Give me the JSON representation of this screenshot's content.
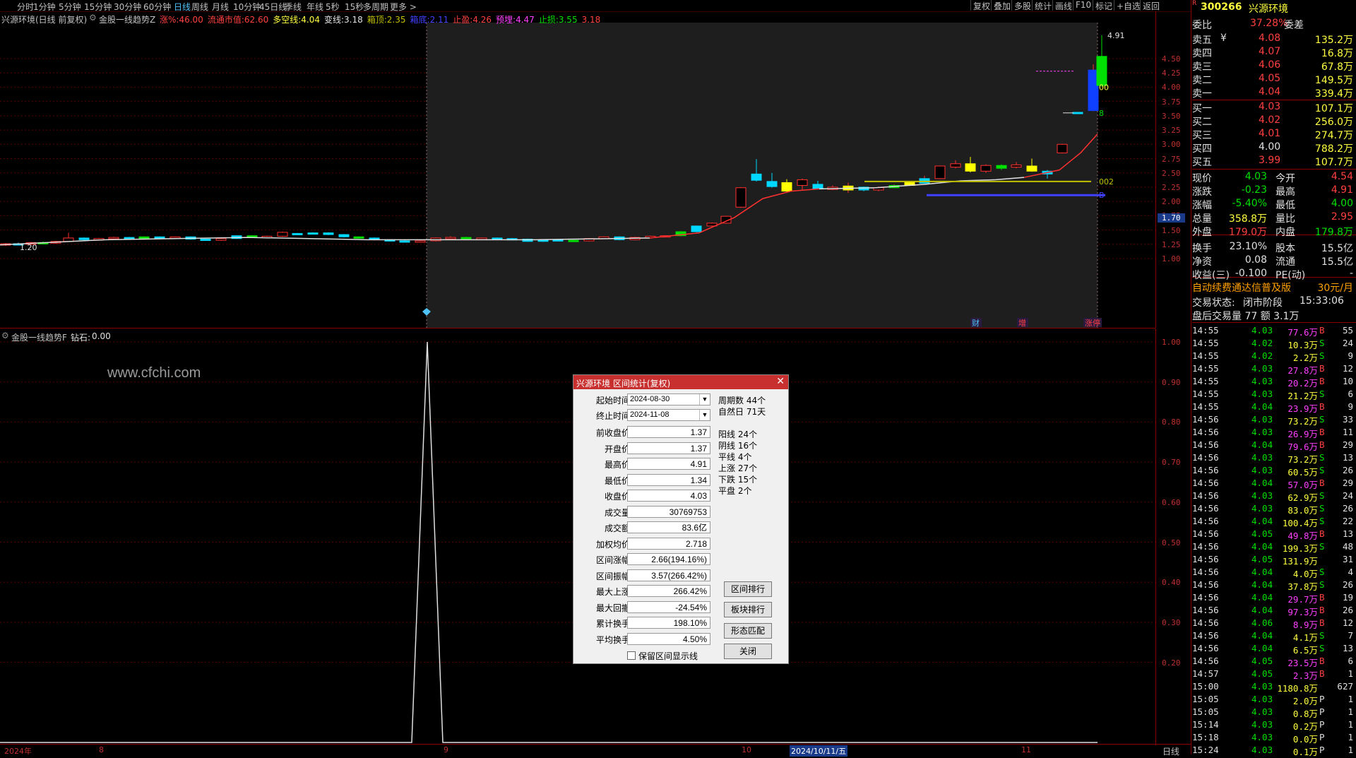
{
  "toolbar": {
    "periods": [
      "分时",
      "1分钟",
      "5分钟",
      "15分钟",
      "30分钟",
      "60分钟",
      "日线",
      "周线",
      "月线",
      "10分钟",
      "45日线",
      "季线",
      "年线",
      "5秒",
      "15秒",
      "多周期",
      "更多 >"
    ],
    "active_period": "日线",
    "right_buttons": [
      "复权",
      "叠加",
      "多股",
      "统计",
      "画线",
      "F10",
      "标记",
      "+自选",
      "返回"
    ]
  },
  "main_chart": {
    "stock_info": "兴源环境(日线 前复权)",
    "indicator_name": "金股一线趋势Z",
    "params": [
      {
        "label": "涨%:",
        "value": "46.00",
        "color": "#ff4040"
      },
      {
        "label": "流通市值:",
        "value": "62.60",
        "color": "#ff4040"
      },
      {
        "label": "多空线:",
        "value": "4.04",
        "color": "#ffff40"
      },
      {
        "label": "变线:",
        "value": "3.18",
        "color": "#e0e0e0"
      },
      {
        "label": "箱顶:",
        "value": "2.35",
        "color": "#c0c000"
      },
      {
        "label": "箱底:",
        "value": "2.11",
        "color": "#4040ff"
      },
      {
        "label": "止盈:",
        "value": "4.26",
        "color": "#ff4040"
      },
      {
        "label": "预埋:",
        "value": "4.47",
        "color": "#ff40ff"
      },
      {
        "label": "止损:",
        "value": "3.55",
        "color": "#00e000"
      },
      {
        "label": "",
        "value": "3.18",
        "color": "#ff4040"
      }
    ],
    "y_axis": [
      "4.50",
      "4.25",
      "4.00",
      "3.75",
      "3.50",
      "3.25",
      "3.00",
      "2.75",
      "2.50",
      "2.25",
      "2.00",
      "1.75",
      "1.50",
      "1.25",
      "1.00"
    ],
    "current_marker": "1.70",
    "annotations": {
      "high": "4.91",
      "low": "1.20",
      "level_a": "002",
      "level_b": "00",
      "level_c": "8",
      "box_label": "B"
    },
    "event_tags": [
      "财",
      "增",
      "涨停"
    ]
  },
  "indicator": {
    "name": "金股一线趋势F",
    "label": "钻石:",
    "value": "0.00",
    "watermark": "www.cfchi.com",
    "y_axis": [
      "1.00",
      "0.90",
      "0.80",
      "0.70",
      "0.60",
      "0.50",
      "0.40",
      "0.30",
      "0.20"
    ]
  },
  "x_axis": {
    "labels": [
      "2024年",
      "8",
      "9",
      "10",
      "2024/10/11/五",
      "11"
    ],
    "period_label": "日线"
  },
  "quote": {
    "code": "300266",
    "name": "兴源环境",
    "r_badge": "R",
    "weibi_label": "委比",
    "weibi": "37.28%",
    "weicha_label": "委差",
    "weicha": "",
    "asks": [
      {
        "label": "卖五",
        "sym": "¥",
        "price": "4.08",
        "vol": "135.2万"
      },
      {
        "label": "卖四",
        "sym": "",
        "price": "4.07",
        "vol": "16.8万"
      },
      {
        "label": "卖三",
        "sym": "",
        "price": "4.06",
        "vol": "67.8万"
      },
      {
        "label": "卖二",
        "sym": "",
        "price": "4.05",
        "vol": "149.5万"
      },
      {
        "label": "卖一",
        "sym": "",
        "price": "4.04",
        "vol": "339.4万"
      }
    ],
    "bids": [
      {
        "label": "买一",
        "price": "4.03",
        "vol": "107.1万"
      },
      {
        "label": "买二",
        "price": "4.02",
        "vol": "256.0万"
      },
      {
        "label": "买三",
        "price": "4.01",
        "vol": "274.7万"
      },
      {
        "label": "买四",
        "price": "4.00",
        "vol": "788.2万"
      },
      {
        "label": "买五",
        "price": "3.99",
        "vol": "107.7万"
      }
    ],
    "stats": [
      {
        "l1": "现价",
        "v1": "4.03",
        "c1": "#00e000",
        "l2": "今开",
        "v2": "4.54",
        "c2": "#ff4040"
      },
      {
        "l1": "涨跌",
        "v1": "-0.23",
        "c1": "#00e000",
        "l2": "最高",
        "v2": "4.91",
        "c2": "#ff4040"
      },
      {
        "l1": "涨幅",
        "v1": "-5.40%",
        "c1": "#00e000",
        "l2": "最低",
        "v2": "4.00",
        "c2": "#00e000"
      },
      {
        "l1": "总量",
        "v1": "358.8万",
        "c1": "#ffff40",
        "l2": "量比",
        "v2": "2.95",
        "c2": "#ff4040"
      },
      {
        "l1": "外盘",
        "v1": "179.0万",
        "c1": "#ff4040",
        "l2": "内盘",
        "v2": "179.8万",
        "c2": "#00e000"
      },
      {
        "l1": "换手",
        "v1": "23.10%",
        "c1": "#e0e0e0",
        "l2": "股本",
        "v2": "15.5亿",
        "c2": "#e0e0e0"
      },
      {
        "l1": "净资",
        "v1": "0.08",
        "c1": "#e0e0e0",
        "l2": "流通",
        "v2": "15.5亿",
        "c2": "#e0e0e0"
      },
      {
        "l1": "收益(三)",
        "v1": "-0.100",
        "c1": "#e0e0e0",
        "l2": "PE(动)",
        "v2": "-",
        "c2": "#e0e0e0"
      }
    ],
    "promo": "自动续费通达信普及版",
    "promo_price": "30元/月",
    "trade_state_label": "交易状态:",
    "trade_state": "闭市阶段",
    "trade_time": "15:33:06",
    "after_hours": "盘后交易量 77 额 3.1万"
  },
  "trades": [
    {
      "t": "14:55",
      "p": "4.03",
      "v": "77.6万",
      "s": "B",
      "n": "55"
    },
    {
      "t": "14:55",
      "p": "4.02",
      "v": "10.3万",
      "s": "S",
      "n": "24"
    },
    {
      "t": "14:55",
      "p": "4.02",
      "v": "2.2万",
      "s": "S",
      "n": "9"
    },
    {
      "t": "14:55",
      "p": "4.03",
      "v": "27.8万",
      "s": "B",
      "n": "12"
    },
    {
      "t": "14:55",
      "p": "4.03",
      "v": "20.2万",
      "s": "B",
      "n": "10"
    },
    {
      "t": "14:55",
      "p": "4.03",
      "v": "21.2万",
      "s": "S",
      "n": "6"
    },
    {
      "t": "14:55",
      "p": "4.04",
      "v": "23.9万",
      "s": "B",
      "n": "9"
    },
    {
      "t": "14:56",
      "p": "4.03",
      "v": "73.2万",
      "s": "S",
      "n": "33"
    },
    {
      "t": "14:56",
      "p": "4.03",
      "v": "26.9万",
      "s": "B",
      "n": "11"
    },
    {
      "t": "14:56",
      "p": "4.04",
      "v": "79.6万",
      "s": "B",
      "n": "29"
    },
    {
      "t": "14:56",
      "p": "4.03",
      "v": "73.2万",
      "s": "S",
      "n": "13"
    },
    {
      "t": "14:56",
      "p": "4.03",
      "v": "60.5万",
      "s": "S",
      "n": "26"
    },
    {
      "t": "14:56",
      "p": "4.04",
      "v": "57.0万",
      "s": "B",
      "n": "29"
    },
    {
      "t": "14:56",
      "p": "4.03",
      "v": "62.9万",
      "s": "S",
      "n": "24"
    },
    {
      "t": "14:56",
      "p": "4.03",
      "v": "83.0万",
      "s": "S",
      "n": "26"
    },
    {
      "t": "14:56",
      "p": "4.04",
      "v": "100.4万",
      "s": "S",
      "n": "22"
    },
    {
      "t": "14:56",
      "p": "4.05",
      "v": "49.8万",
      "s": "B",
      "n": "13"
    },
    {
      "t": "14:56",
      "p": "4.04",
      "v": "199.3万",
      "s": "S",
      "n": "48"
    },
    {
      "t": "14:56",
      "p": "4.05",
      "v": "131.9万",
      "s": "",
      "n": "31"
    },
    {
      "t": "14:56",
      "p": "4.04",
      "v": "4.0万",
      "s": "S",
      "n": "4"
    },
    {
      "t": "14:56",
      "p": "4.04",
      "v": "37.8万",
      "s": "S",
      "n": "26"
    },
    {
      "t": "14:56",
      "p": "4.04",
      "v": "29.7万",
      "s": "B",
      "n": "19"
    },
    {
      "t": "14:56",
      "p": "4.04",
      "v": "97.3万",
      "s": "B",
      "n": "26"
    },
    {
      "t": "14:56",
      "p": "4.06",
      "v": "8.9万",
      "s": "B",
      "n": "12"
    },
    {
      "t": "14:56",
      "p": "4.04",
      "v": "4.1万",
      "s": "S",
      "n": "7"
    },
    {
      "t": "14:56",
      "p": "4.04",
      "v": "6.5万",
      "s": "S",
      "n": "13"
    },
    {
      "t": "14:56",
      "p": "4.05",
      "v": "23.5万",
      "s": "B",
      "n": "6"
    },
    {
      "t": "14:57",
      "p": "4.05",
      "v": "2.3万",
      "s": "B",
      "n": "1"
    },
    {
      "t": "15:00",
      "p": "4.03",
      "v": "1180.8万",
      "s": "",
      "n": "627"
    },
    {
      "t": "15:05",
      "p": "4.03",
      "v": "2.0万",
      "s": "P",
      "n": "1"
    },
    {
      "t": "15:05",
      "p": "4.03",
      "v": "0.8万",
      "s": "P",
      "n": "1"
    },
    {
      "t": "15:14",
      "p": "4.03",
      "v": "0.2万",
      "s": "P",
      "n": "1"
    },
    {
      "t": "15:18",
      "p": "4.03",
      "v": "0.0万",
      "s": "P",
      "n": "1"
    },
    {
      "t": "15:24",
      "p": "4.03",
      "v": "0.1万",
      "s": "P",
      "n": "1"
    }
  ],
  "dialog": {
    "title": "兴源环境 区间统计(复权)",
    "start_label": "起始时间",
    "start_value": "2024-08-30",
    "end_label": "终止时间",
    "end_value": "2024-11-08",
    "fields": [
      {
        "label": "前收盘价",
        "value": "1.37"
      },
      {
        "label": "开盘价",
        "value": "1.37"
      },
      {
        "label": "最高价",
        "value": "4.91"
      },
      {
        "label": "最低价",
        "value": "1.34"
      },
      {
        "label": "收盘价",
        "value": "4.03"
      },
      {
        "label": "成交量",
        "value": "30769753"
      },
      {
        "label": "成交额",
        "value": "83.6亿"
      },
      {
        "label": "加权均价",
        "value": "2.718"
      },
      {
        "label": "区间涨幅",
        "value": "2.66(194.16%)"
      },
      {
        "label": "区间振幅",
        "value": "3.57(266.42%)"
      },
      {
        "label": "最大上涨",
        "value": "266.42%"
      },
      {
        "label": "最大回撤",
        "value": "-24.54%"
      },
      {
        "label": "累计换手",
        "value": "198.10%"
      },
      {
        "label": "平均换手",
        "value": "4.50%"
      }
    ],
    "stats": [
      "周期数 44个",
      "自然日 71天",
      "阳线 24个",
      "阴线 16个",
      "平线 4个",
      "上涨 27个",
      "下跌 15个",
      "平盘 2个"
    ],
    "buttons": [
      "区间排行",
      "板块排行",
      "形态匹配",
      "关闭"
    ],
    "checkbox_label": "保留区间显示线"
  }
}
